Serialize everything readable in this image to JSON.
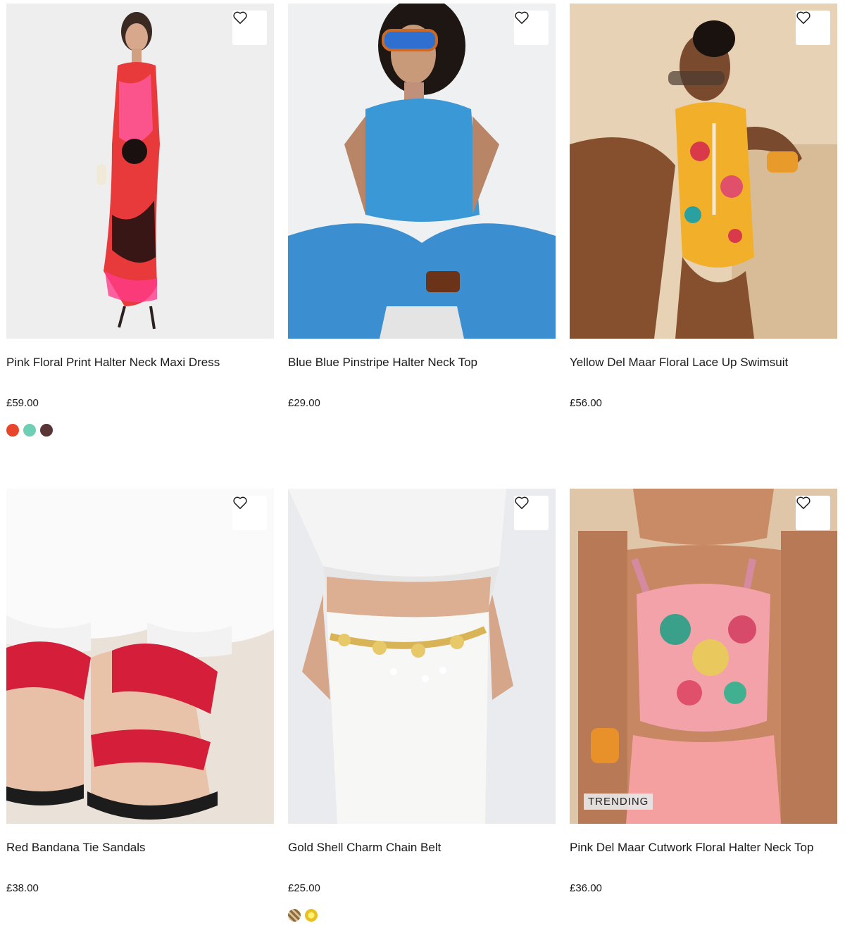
{
  "products": [
    {
      "name": "Pink Floral Print Halter Neck Maxi Dress",
      "price": "£59.00",
      "image": "model in red and pink floral halter maxi dress",
      "swatches": [
        "#e8452a",
        "#6fcfb4",
        "#5a3535"
      ],
      "badge": ""
    },
    {
      "name": "Blue Blue Pinstripe Halter Neck Top",
      "price": "£29.00",
      "image": "model in blue halter top and blue trousers seated",
      "swatches": [],
      "badge": ""
    },
    {
      "name": "Yellow Del Maar Floral Lace Up Swimsuit",
      "price": "£56.00",
      "image": "model in yellow floral lace up swimsuit",
      "swatches": [],
      "badge": ""
    },
    {
      "name": "Red Bandana Tie Sandals",
      "price": "£38.00",
      "image": "feet wearing red bandana tie sandals",
      "swatches": [],
      "badge": ""
    },
    {
      "name": "Gold Shell Charm Chain Belt",
      "price": "£25.00",
      "image": "gold shell charm chain belt on white crochet skirt",
      "swatches": [
        "#a89060",
        "#f2d23a"
      ],
      "badge": ""
    },
    {
      "name": "Pink Del Maar Cutwork Floral Halter Neck Top",
      "price": "£36.00",
      "image": "model in pink cutwork floral halter neck top",
      "swatches": [],
      "badge": "TRENDING"
    }
  ],
  "icons": {
    "wishlist": "heart-outline-icon"
  }
}
